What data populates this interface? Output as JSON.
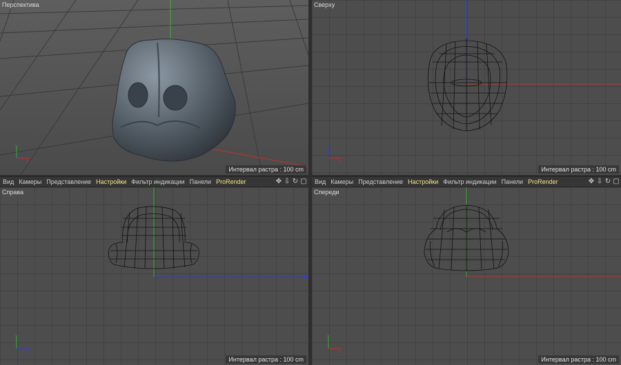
{
  "menubar": {
    "items": [
      {
        "label": "Вид",
        "active": false
      },
      {
        "label": "Камеры",
        "active": false
      },
      {
        "label": "Представление",
        "active": false
      },
      {
        "label": "Настройки",
        "active": true
      },
      {
        "label": "Фильтр индикации",
        "active": false
      },
      {
        "label": "Панели",
        "active": false
      },
      {
        "label": "ProRender",
        "active": true
      }
    ],
    "icons": [
      "move-icon",
      "arrow-down-icon",
      "rotate-icon",
      "maximize-icon"
    ]
  },
  "viewports": {
    "perspective": {
      "title": "Перспектива",
      "status": "Интервал растра : 100 cm"
    },
    "top": {
      "title": "Сверху",
      "status": "Интервал растра : 100 cm"
    },
    "right": {
      "title": "Справа",
      "status": "Интервал растра : 100 cm"
    },
    "front": {
      "title": "Спереди",
      "status": "Интервал растра : 100 cm"
    }
  },
  "colors": {
    "accent": "#f4e58a",
    "axis_x": "#c03030",
    "axis_y": "#30b030",
    "axis_z": "#3040d0"
  }
}
